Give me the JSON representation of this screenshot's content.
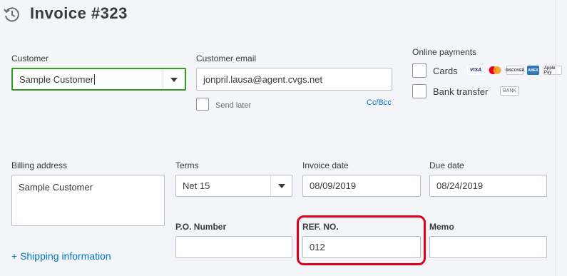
{
  "header": {
    "title": "Invoice #323",
    "history_icon": "history-clock-icon"
  },
  "customer": {
    "label": "Customer",
    "value": "Sample Customer"
  },
  "email": {
    "label": "Customer email",
    "value": "jonpril.lausa@agent.cvgs.net",
    "send_later": "Send later",
    "cc_bcc": "Cc/Bcc"
  },
  "online_payments": {
    "label": "Online payments",
    "cards": "Cards",
    "bank_transfer": "Bank transfer",
    "bank_badge": "BANK",
    "card_brands": [
      "VISA",
      "mastercard",
      "DISCOVER",
      "AMEX",
      "Apple Pay"
    ]
  },
  "billing": {
    "label": "Billing address",
    "value": "Sample Customer"
  },
  "terms": {
    "label": "Terms",
    "value": "Net 15"
  },
  "invoice_date": {
    "label": "Invoice date",
    "value": "08/09/2019"
  },
  "due_date": {
    "label": "Due date",
    "value": "08/24/2019"
  },
  "po": {
    "label": "P.O. Number",
    "value": ""
  },
  "ref": {
    "label": "REF. NO.",
    "value": "012"
  },
  "memo": {
    "label": "Memo",
    "value": ""
  },
  "shipping": {
    "label": "+ Shipping information"
  },
  "colors": {
    "accent_green": "#2ca01c",
    "link_blue": "#0077c5",
    "highlight_red": "#e0001b"
  }
}
